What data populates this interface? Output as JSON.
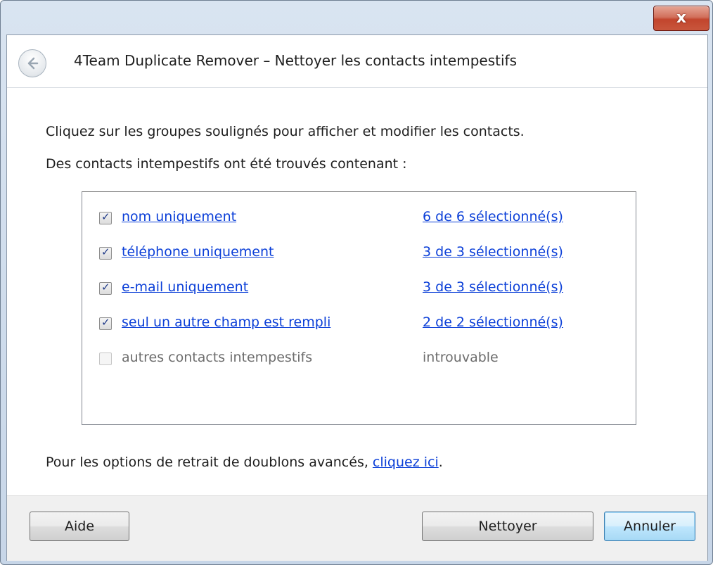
{
  "window": {
    "title": "4Team Duplicate Remover – Nettoyer les contacts intempestifs",
    "close_label": "x"
  },
  "content": {
    "instruction": "Cliquez sur les groupes soulignés pour afficher et modifier les contacts.",
    "found_text": "Des contacts intempestifs ont été trouvés contenant :",
    "items": [
      {
        "label": "nom uniquement",
        "count": "6 de 6 sélectionné(s)",
        "checked": true,
        "enabled": true
      },
      {
        "label": "téléphone uniquement",
        "count": "3 de 3 sélectionné(s)",
        "checked": true,
        "enabled": true
      },
      {
        "label": "e-mail uniquement",
        "count": "3 de 3 sélectionné(s)",
        "checked": true,
        "enabled": true
      },
      {
        "label": "seul un autre champ est rempli",
        "count": "2 de 2 sélectionné(s)",
        "checked": true,
        "enabled": true
      },
      {
        "label": "autres contacts intempestifs",
        "count": "introuvable",
        "checked": false,
        "enabled": false
      }
    ],
    "advanced_prefix": "Pour les options de retrait de doublons avancés, ",
    "advanced_link": "cliquez ici",
    "advanced_suffix": "."
  },
  "footer": {
    "help_label": "Aide",
    "clean_label": "Nettoyer",
    "cancel_label": "Annuler"
  }
}
